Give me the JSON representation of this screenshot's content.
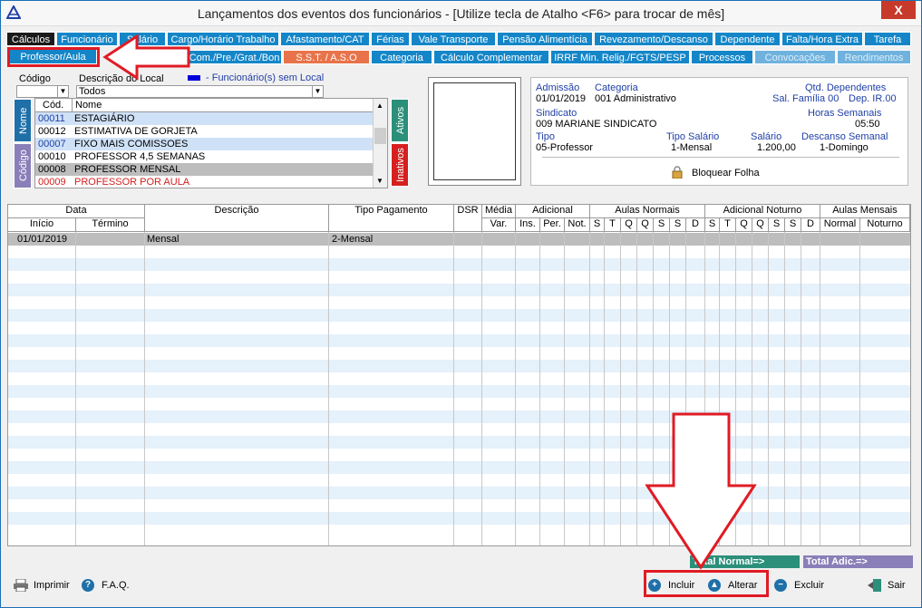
{
  "window": {
    "title": "Lançamentos dos eventos dos funcionários - [Utilize tecla de Atalho <F6> para trocar de mês]",
    "close_label": "X"
  },
  "tabs_row1": [
    "Cálculos",
    "Funcionário",
    "Salário",
    "Cargo/Horário Trabalho",
    "Afastamento/CAT",
    "Férias",
    "Vale Transporte",
    "Pensão Alimentícia",
    "Revezamento/Descanso",
    "Dependente",
    "Falta/Hora Extra",
    "Tarefa"
  ],
  "tabs_row2": [
    "Professor/Aula",
    "Com./Pre./Grat./Bon",
    "S.S.T. / A.S.O",
    "Categoria",
    "Cálculo Complementar",
    "IRRF Min. Relig./FGTS/PESP",
    "Processos",
    "Convocações",
    "Rendimentos"
  ],
  "filters": {
    "codigo_label": "Código",
    "descricao_label": "Descrição do Local",
    "descricao_value": "Todos",
    "legend_text": "- Funcionário(s) sem Local"
  },
  "side_tabs": {
    "nome": "Nome",
    "codigo": "Código",
    "ativos": "Ativos",
    "inativos": "Inativos"
  },
  "employee_list": {
    "col_cod": "Cód.",
    "col_nome": "Nome",
    "rows": [
      {
        "cod": "00011",
        "nome": "ESTAGIÁRIO"
      },
      {
        "cod": "00012",
        "nome": "ESTIMATIVA DE GORJETA"
      },
      {
        "cod": "00007",
        "nome": "FIXO MAIS COMISSOES"
      },
      {
        "cod": "00010",
        "nome": "PROFESSOR 4,5 SEMANAS"
      },
      {
        "cod": "00008",
        "nome": "PROFESSOR MENSAL"
      },
      {
        "cod": "00009",
        "nome": "PROFESSOR POR AULA"
      }
    ]
  },
  "info": {
    "admissao_label": "Admissão",
    "admissao": "01/01/2019",
    "categoria_label": "Categoria",
    "categoria": "001  Administrativo",
    "qtd_dep_label": "Qtd. Dependentes",
    "sal_familia": "Sal. Família 00",
    "dep_ir": "Dep. IR.00",
    "sindicato_label": "Sindicato",
    "sindicato": "009  MARIANE SINDICATO",
    "horas_label": "Horas Semanais",
    "horas": "05:50",
    "tipo_label": "Tipo",
    "tipo": "05-Professor",
    "tipo_salario_label": "Tipo Salário",
    "tipo_salario": "1-Mensal",
    "salario_label": "Salário",
    "salario": "1.200,00",
    "descanso_label": "Descanso Semanal",
    "descanso": "1-Domingo",
    "bloquear": "Bloquear Folha"
  },
  "grid": {
    "h_data": "Data",
    "h_inicio": "Início",
    "h_termino": "Término",
    "h_descricao": "Descrição",
    "h_tipo_pag": "Tipo Pagamento",
    "h_dsr": "DSR",
    "h_media": "Média",
    "h_var": "Var.",
    "h_adicional": "Adicional",
    "h_ins": "Ins.",
    "h_per": "Per.",
    "h_not": "Not.",
    "h_aulas_normais": "Aulas Normais",
    "h_adicional_noturno": "Adicional Noturno",
    "h_aulas_mensais": "Aulas Mensais",
    "h_normal": "Normal",
    "h_noturno": "Noturno",
    "days": [
      "S",
      "T",
      "Q",
      "Q",
      "S",
      "S",
      "D"
    ],
    "rows": [
      {
        "inicio": "01/01/2019",
        "termino": "",
        "descricao": "Mensal",
        "tipo_pagamento": "2-Mensal"
      }
    ]
  },
  "totals": {
    "normal": "Total Normal=>",
    "adic": "Total Adic.=>"
  },
  "buttons": {
    "imprimir": "Imprimir",
    "faq": "F.A.Q.",
    "incluir": "Incluir",
    "alterar": "Alterar",
    "excluir": "Excluir",
    "sair": "Sair"
  },
  "colors": {
    "tab_blue": "#1486c8",
    "annotation_red": "#e01b24",
    "label_blue": "#1f3fa6"
  }
}
